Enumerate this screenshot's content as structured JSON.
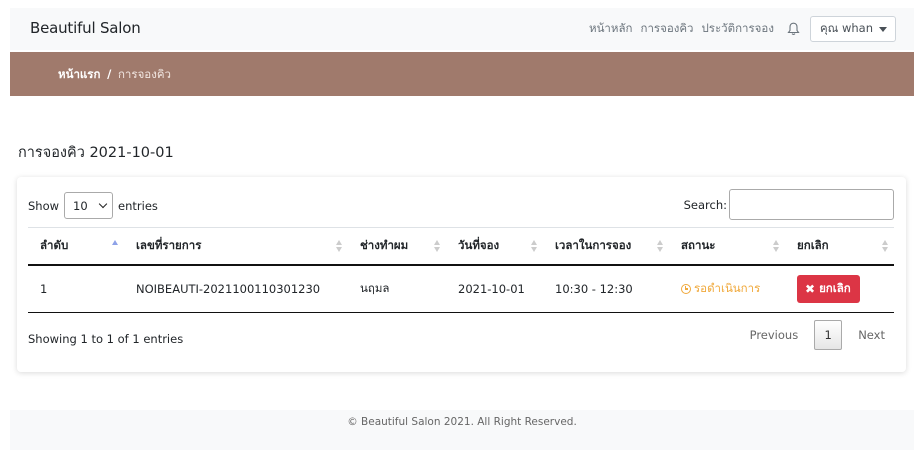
{
  "navbar": {
    "brand": "Beautiful Salon",
    "links": [
      "หน้าหลัก",
      "การจองคิว",
      "ประวัติการจอง"
    ],
    "notification_icon": "bell-icon",
    "user_menu": "คุณ whan"
  },
  "breadcrumb": {
    "home": "หน้าแรก",
    "separator": "/",
    "current": "การจองคิว"
  },
  "page": {
    "heading": "การจองคิว 2021-10-01"
  },
  "table_controls": {
    "show_label": "Show",
    "entries_value": "10",
    "entries_label": "entries",
    "search_label": "Search:",
    "search_value": ""
  },
  "table": {
    "columns": [
      "ลำดับ",
      "เลขที่รายการ",
      "ช่างทำผม",
      "วันที่จอง",
      "เวลาในการจอง",
      "สถานะ",
      "ยกเลิก"
    ],
    "rows": [
      {
        "no": "1",
        "ref": "NOIBEAUTI-2021100110301230",
        "stylist": "นฤมล",
        "date": "2021-10-01",
        "time": "10:30 - 12:30",
        "status": "รอดำเนินการ",
        "cancel_label": "ยกเลิก"
      }
    ]
  },
  "pagination": {
    "info": "Showing 1 to 1 of 1 entries",
    "previous": "Previous",
    "current_page": "1",
    "next": "Next"
  },
  "footer": {
    "text": "© Beautiful Salon 2021. All Right Reserved."
  },
  "colors": {
    "breadcrumb_band": "#a07a6c",
    "status_pending": "#f0a83a",
    "cancel_button": "#dc3545",
    "navbar_bg": "#f8f9fa"
  }
}
